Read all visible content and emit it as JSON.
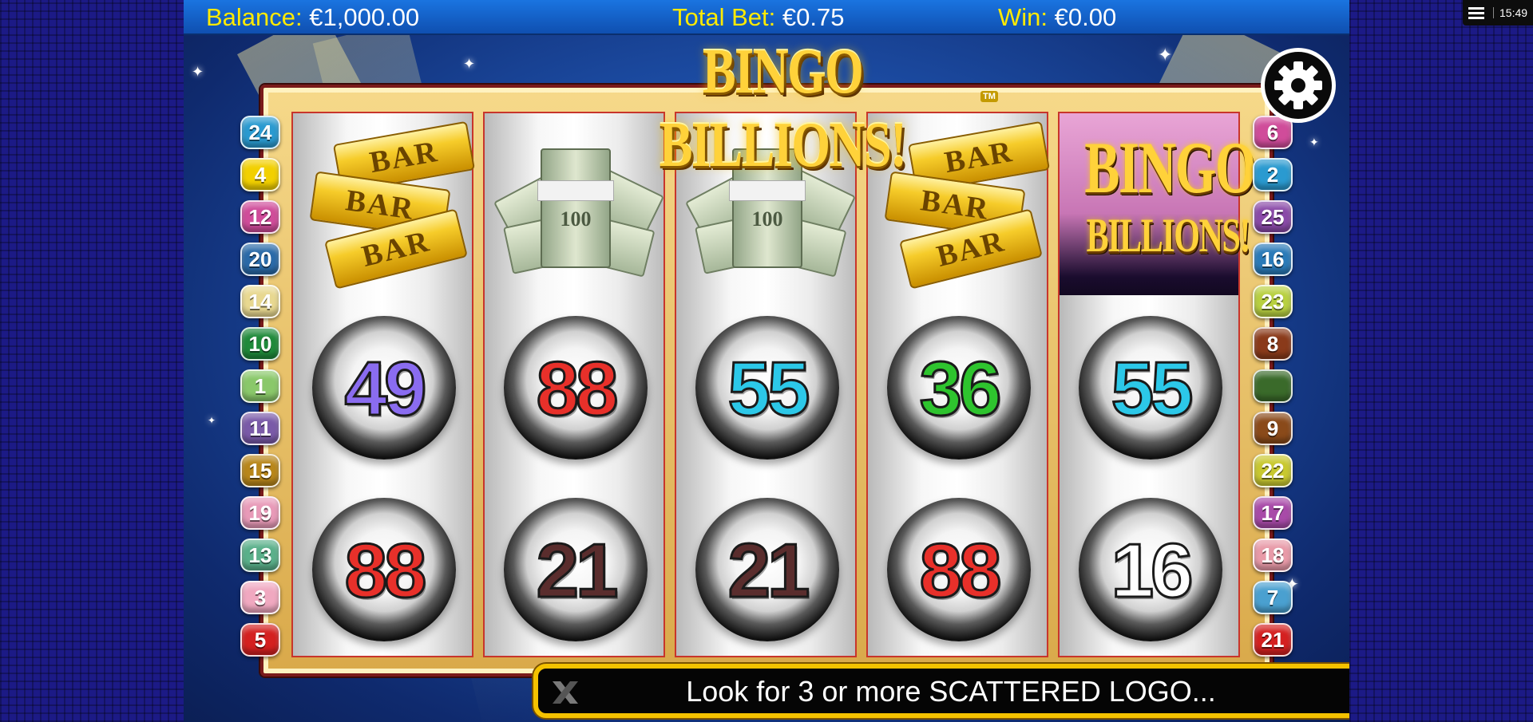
{
  "hud": {
    "balance_label": "Balance:",
    "balance_value": "€1,000.00",
    "bet_label": "Total Bet:",
    "bet_value": "€0.75",
    "win_label": "Win:",
    "win_value": "€0.00"
  },
  "logo": {
    "title": "BINGO BILLIONS!",
    "tm": "TM"
  },
  "reels": [
    {
      "top": {
        "type": "gold-bars",
        "text": [
          "BAR",
          "BAR",
          "BAR"
        ]
      },
      "balls": [
        {
          "number": "49",
          "color": "#8a6cf0"
        },
        {
          "number": "88",
          "color": "#e8302a"
        }
      ]
    },
    {
      "top": {
        "type": "cash-stack",
        "text": "100"
      },
      "balls": [
        {
          "number": "88",
          "color": "#e8302a"
        },
        {
          "number": "21",
          "color": "#5a2d2d"
        }
      ]
    },
    {
      "top": {
        "type": "cash-stack",
        "text": "100"
      },
      "balls": [
        {
          "number": "55",
          "color": "#2cc8e8"
        },
        {
          "number": "21",
          "color": "#5a2d2d"
        }
      ]
    },
    {
      "top": {
        "type": "gold-bars",
        "text": [
          "BAR",
          "BAR",
          "BAR"
        ]
      },
      "balls": [
        {
          "number": "36",
          "color": "#2ec42e"
        },
        {
          "number": "88",
          "color": "#e8302a"
        }
      ]
    },
    {
      "top": {
        "type": "scatter-logo",
        "line1": "BINGO",
        "line2": "BILLIONS!"
      },
      "balls": [
        {
          "number": "55",
          "color": "#2cc8e8"
        },
        {
          "number": "16",
          "color": "#ffffff"
        }
      ]
    }
  ],
  "paylines_left": [
    {
      "n": "24",
      "color": "#2a9ad0"
    },
    {
      "n": "4",
      "color": "#f2d000"
    },
    {
      "n": "12",
      "color": "#d04c9a"
    },
    {
      "n": "20",
      "color": "#2a6aa8"
    },
    {
      "n": "14",
      "color": "#e8d890"
    },
    {
      "n": "10",
      "color": "#1f8a3a"
    },
    {
      "n": "1",
      "color": "#8ac86a"
    },
    {
      "n": "11",
      "color": "#7a5aa8"
    },
    {
      "n": "15",
      "color": "#b8861a"
    },
    {
      "n": "19",
      "color": "#e89ab8"
    },
    {
      "n": "13",
      "color": "#5ab08a"
    },
    {
      "n": "3",
      "color": "#f0a8c0"
    },
    {
      "n": "5",
      "color": "#d42020"
    }
  ],
  "paylines_right": [
    {
      "n": "6",
      "color": "#d04c9a"
    },
    {
      "n": "2",
      "color": "#2a9ad0"
    },
    {
      "n": "25",
      "color": "#8a4aa8"
    },
    {
      "n": "16",
      "color": "#2a7ab8"
    },
    {
      "n": "23",
      "color": "#b8d040"
    },
    {
      "n": "8",
      "color": "#8a3a1a"
    },
    {
      "n": "",
      "color": "#3a6a2a"
    },
    {
      "n": "9",
      "color": "#8a4a1a"
    },
    {
      "n": "22",
      "color": "#c8c830"
    },
    {
      "n": "17",
      "color": "#a84aa8"
    },
    {
      "n": "18",
      "color": "#e89aa8"
    },
    {
      "n": "7",
      "color": "#4aa0d0"
    },
    {
      "n": "21",
      "color": "#d42020"
    }
  ],
  "message": "Look for 3 or more SCATTERED LOGO...",
  "system": {
    "time": "15:49"
  },
  "icons": {
    "settings": "gear-icon",
    "spin": "play-icon",
    "close": "x-logo-icon",
    "menu": "hamburger-icon"
  }
}
